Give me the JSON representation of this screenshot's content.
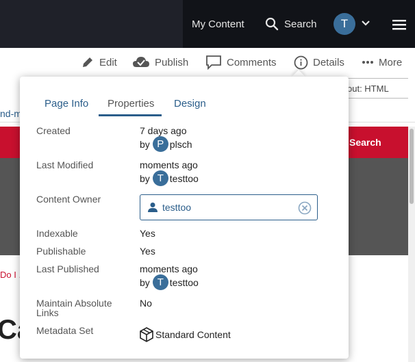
{
  "nav": {
    "my_content": "My Content",
    "search": "Search",
    "user_initial": "T"
  },
  "toolbar": {
    "edit": "Edit",
    "publish": "Publish",
    "comments": "Comments",
    "details": "Details",
    "more": "More"
  },
  "background": {
    "select_value": "out: HTML",
    "breadcrumb": "nd-m",
    "search_button": "Search",
    "doi_text": "Do I .",
    "heading_fragment": "Cas"
  },
  "popover": {
    "tabs": [
      "Page Info",
      "Properties",
      "Design"
    ],
    "active_tab": "Properties",
    "created_label": "Created",
    "created_value": "7 days ago",
    "created_by_initial": "P",
    "created_by_name": "plsch",
    "modified_label": "Last Modified",
    "modified_value": "moments ago",
    "modified_by_initial": "T",
    "modified_by_name": "testtoo",
    "owner_label": "Content Owner",
    "owner_value": "testtoo",
    "indexable_label": "Indexable",
    "indexable_value": "Yes",
    "publishable_label": "Publishable",
    "publishable_value": "Yes",
    "published_label": "Last Published",
    "published_value": "moments ago",
    "published_by_initial": "T",
    "published_by_name": "testtoo",
    "maintain_label": "Maintain Absolute Links",
    "maintain_value": "No",
    "metadata_label": "Metadata Set",
    "metadata_value": "Standard Content"
  },
  "colors": {
    "accent": "#2a5d8a",
    "nav_bg": "#1f2129",
    "banner_red": "#c8102e"
  }
}
